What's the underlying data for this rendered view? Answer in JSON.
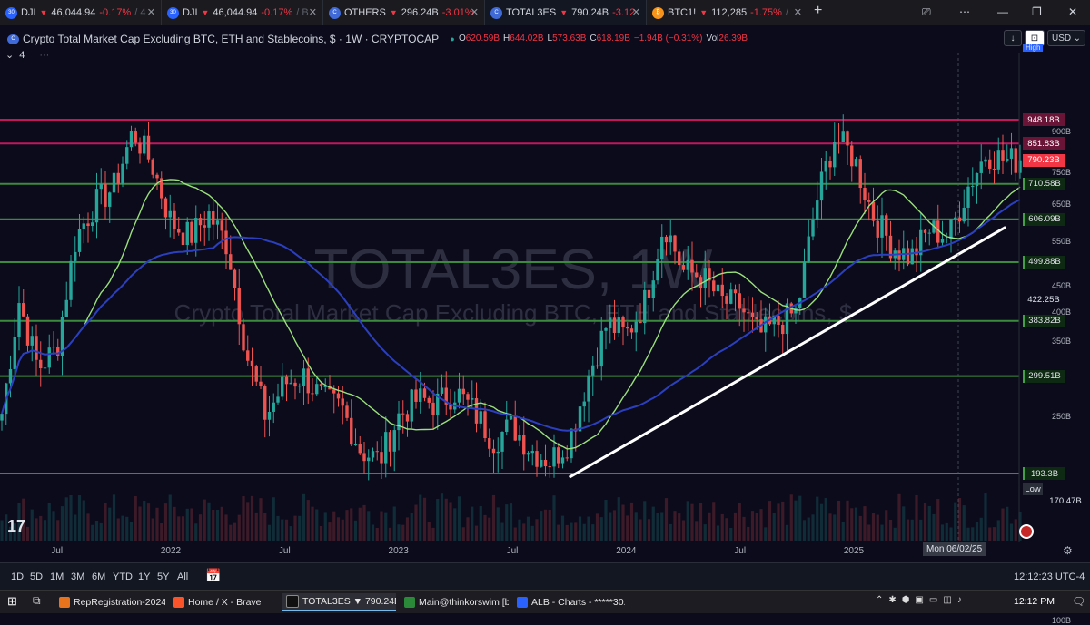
{
  "tabs": [
    {
      "icon_text": "30",
      "icon_color": "#2962ff",
      "symbol": "DJI",
      "price": "46,044.94",
      "change": "-0.17%",
      "extra": "/ 4"
    },
    {
      "icon_text": "30",
      "icon_color": "#2962ff",
      "symbol": "DJI",
      "price": "46,044.94",
      "change": "-0.17%",
      "extra": "/ B"
    },
    {
      "icon_text": "C",
      "icon_color": "#3f6ad8",
      "symbol": "OTHERS",
      "price": "296.24B",
      "change": "-3.01%",
      "extra": ""
    },
    {
      "icon_text": "C",
      "icon_color": "#3f6ad8",
      "symbol": "TOTAL3ES",
      "price": "790.24B",
      "change": "-3.12",
      "extra": ""
    },
    {
      "icon_text": "₿",
      "icon_color": "#f7931a",
      "symbol": "BTC1!",
      "price": "112,285",
      "change": "-1.75%",
      "extra": "/"
    }
  ],
  "header": {
    "title": "Crypto Total Market Cap Excluding BTC, ETH and Stablecoins, $ · 1W · CRYPTOCAP",
    "open": "620.59B",
    "high": "644.02B",
    "low": "573.63B",
    "close": "618.19B",
    "change": "−1.94B (−0.31%)",
    "vol_label": "Vol",
    "vol": "26.39B",
    "currency": "USD",
    "indicator_count": "4"
  },
  "watermark": {
    "line1": "TOTAL3ES, 1W",
    "line2": "Crypto Total Market Cap Excluding BTC, ETH and Stablecoins, $"
  },
  "price_levels": [
    {
      "label": "948.18B",
      "value": 948.18,
      "style": "magenta"
    },
    {
      "label": "851.83B",
      "value": 851.83,
      "style": "magenta"
    },
    {
      "label": "790.23B",
      "value": 790.23,
      "style": "red"
    },
    {
      "label": "710.58B",
      "value": 710.58,
      "style": "green"
    },
    {
      "label": "606.09B",
      "value": 606.09,
      "style": "green"
    },
    {
      "label": "499.88B",
      "value": 499.88,
      "style": "green"
    },
    {
      "label": "422.25B",
      "value": 422.25,
      "style": "plain"
    },
    {
      "label": "383.82B",
      "value": 383.82,
      "style": "green"
    },
    {
      "label": "299.51B",
      "value": 299.51,
      "style": "green"
    },
    {
      "label": "193.3B",
      "value": 193.3,
      "style": "green"
    },
    {
      "label": "170.47B",
      "value": 170.47,
      "style": "plain"
    }
  ],
  "axis_ticks": [
    "900B",
    "750B",
    "650B",
    "550B",
    "450B",
    "400B",
    "350B",
    "250B",
    "100B"
  ],
  "high_label": "High",
  "low_label": "Low",
  "x_labels": [
    "Jul",
    "2022",
    "Jul",
    "2023",
    "Jul",
    "2024",
    "Jul",
    "2025"
  ],
  "crosshair_date": "Mon 06/02/25",
  "colors": {
    "up": "#26a69a",
    "down": "#ef5350",
    "ma_fast": "#9be07a",
    "ma_slow": "#2b3fbf",
    "trend": "#ffffff",
    "level_green": "#3c8a3c",
    "level_magenta": "#c2185b"
  },
  "chart_data": {
    "type": "candlestick",
    "symbol": "TOTAL3ES",
    "interval": "1W",
    "x_range": [
      "2021-04",
      "2025-09"
    ],
    "y_range_billions": [
      90,
      1080
    ],
    "y_scale": "log",
    "horizontal_levels": [
      948.18,
      851.83,
      710.58,
      606.09,
      499.88,
      383.82,
      299.51,
      193.3
    ],
    "last_price": 790.23,
    "visible_high": "High",
    "visible_low": 170.47,
    "series": [
      {
        "type": "moving-average",
        "color": "#9be07a"
      },
      {
        "type": "moving-average",
        "color": "#2b3fbf"
      },
      {
        "type": "trendline",
        "color": "#ffffff",
        "from": {
          "date": "2023-10",
          "value": 190
        },
        "to": {
          "date": "2025-09",
          "value": 585
        }
      }
    ],
    "approx_weekly_closes": [
      [
        "2021-04",
        240
      ],
      [
        "2021-05",
        420
      ],
      [
        "2021-06",
        310
      ],
      [
        "2021-07",
        340
      ],
      [
        "2021-08",
        560
      ],
      [
        "2021-09",
        650
      ],
      [
        "2021-10",
        700
      ],
      [
        "2021-11",
        900
      ],
      [
        "2021-12",
        780
      ],
      [
        "2022-01",
        600
      ],
      [
        "2022-02",
        560
      ],
      [
        "2022-03",
        620
      ],
      [
        "2022-04",
        540
      ],
      [
        "2022-05",
        330
      ],
      [
        "2022-06",
        250
      ],
      [
        "2022-07",
        290
      ],
      [
        "2022-08",
        300
      ],
      [
        "2022-09",
        270
      ],
      [
        "2022-10",
        260
      ],
      [
        "2022-11",
        215
      ],
      [
        "2022-12",
        205
      ],
      [
        "2023-01",
        250
      ],
      [
        "2023-02",
        270
      ],
      [
        "2023-03",
        265
      ],
      [
        "2023-04",
        280
      ],
      [
        "2023-05",
        255
      ],
      [
        "2023-06",
        225
      ],
      [
        "2023-07",
        240
      ],
      [
        "2023-08",
        215
      ],
      [
        "2023-09",
        205
      ],
      [
        "2023-10",
        225
      ],
      [
        "2023-11",
        300
      ],
      [
        "2023-12",
        380
      ],
      [
        "2024-01",
        360
      ],
      [
        "2024-02",
        420
      ],
      [
        "2024-03",
        600
      ],
      [
        "2024-04",
        480
      ],
      [
        "2024-05",
        470
      ],
      [
        "2024-06",
        420
      ],
      [
        "2024-07",
        410
      ],
      [
        "2024-08",
        360
      ],
      [
        "2024-09",
        380
      ],
      [
        "2024-10",
        400
      ],
      [
        "2024-11",
        650
      ],
      [
        "2024-12",
        880
      ],
      [
        "2025-01",
        800
      ],
      [
        "2025-02",
        620
      ],
      [
        "2025-03",
        540
      ],
      [
        "2025-04",
        510
      ],
      [
        "2025-05",
        580
      ],
      [
        "2025-06",
        560
      ],
      [
        "2025-07",
        700
      ],
      [
        "2025-08",
        820
      ],
      [
        "2025-09",
        790
      ]
    ]
  },
  "ranges": [
    "1D",
    "5D",
    "1M",
    "3M",
    "6M",
    "YTD",
    "1Y",
    "5Y",
    "All"
  ],
  "clock": "12:12:23 UTC-4",
  "taskbar": {
    "apps": [
      {
        "label": "RepRegistration-2024...",
        "color": "#e8731c"
      },
      {
        "label": "Home / X - Brave",
        "color": "#fb542b"
      },
      {
        "label": "TOTAL3ES ▼ 790.24B ...",
        "color": "#111111",
        "active": true
      },
      {
        "label": "Main@thinkorswim [b...",
        "color": "#2a8a3a"
      },
      {
        "label": "ALB - Charts - *****30...",
        "color": "#2962ff"
      }
    ],
    "time": "12:12 PM"
  }
}
